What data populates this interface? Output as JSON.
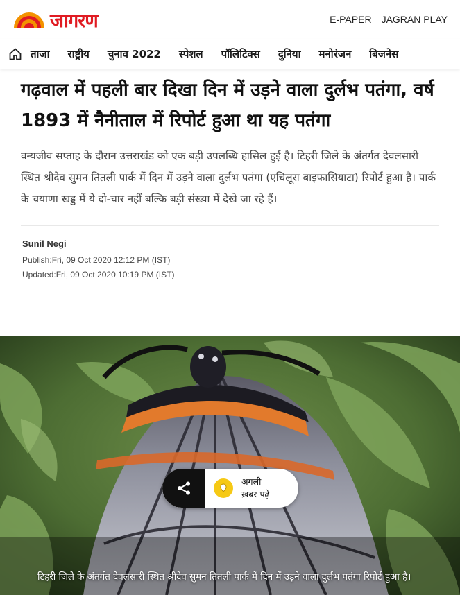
{
  "header": {
    "logo_text": "जागरण",
    "links": [
      "E-PAPER",
      "JAGRAN PLAY"
    ]
  },
  "nav": {
    "home_icon": "home-icon",
    "items": [
      "ताजा",
      "राष्ट्रीय",
      "चुनाव 2022",
      "स्पेशल",
      "पॉलिटिक्स",
      "दुनिया",
      "मनोरंजन",
      "बिजनेस"
    ]
  },
  "article": {
    "headline": "गढ़वाल में पहली बार दिखा दिन में उड़ने वाला दुर्लभ पतंगा, वर्ष 1893 में नैनीताल में रिपोर्ट हुआ था यह पतंगा",
    "summary": "वन्यजीव सप्ताह के दौरान उत्तराखंड को एक बड़ी उपलब्धि हासिल हुई है। टिहरी जिले के अंतर्गत देवलसारी स्थित श्रीदेव सुमन तितली पार्क में दिन में उड़ने वाला दुर्लभ पतंगा (एचिलूरा बाइफासियाटा) रिपोर्ट हुआ है। पार्क के चयाणा खड्ड में ये दो-चार नहीं बल्कि बड़ी संख्या में देखे जा रहे हैं।",
    "author": "Sunil Negi",
    "published": "Publish:Fri, 09 Oct 2020 12:12 PM (IST)",
    "updated": "Updated:Fri, 09 Oct 2020 10:19 PM (IST)",
    "image_caption": "टिहरी जिले के अंतर्गत देवलसारी स्थित श्रीदेव सुमन तितली पार्क में दिन में उड़ने वाला दुर्लभ पतंगा रिपोर्ट हुआ है।"
  },
  "widget": {
    "share_icon": "share-icon",
    "next_label_line1": "अगली",
    "next_label_line2": "ख़बर पढ़ें"
  },
  "colors": {
    "brand_red": "#e01b22",
    "brand_orange": "#f39200",
    "next_icon_yellow": "#f6c915"
  }
}
